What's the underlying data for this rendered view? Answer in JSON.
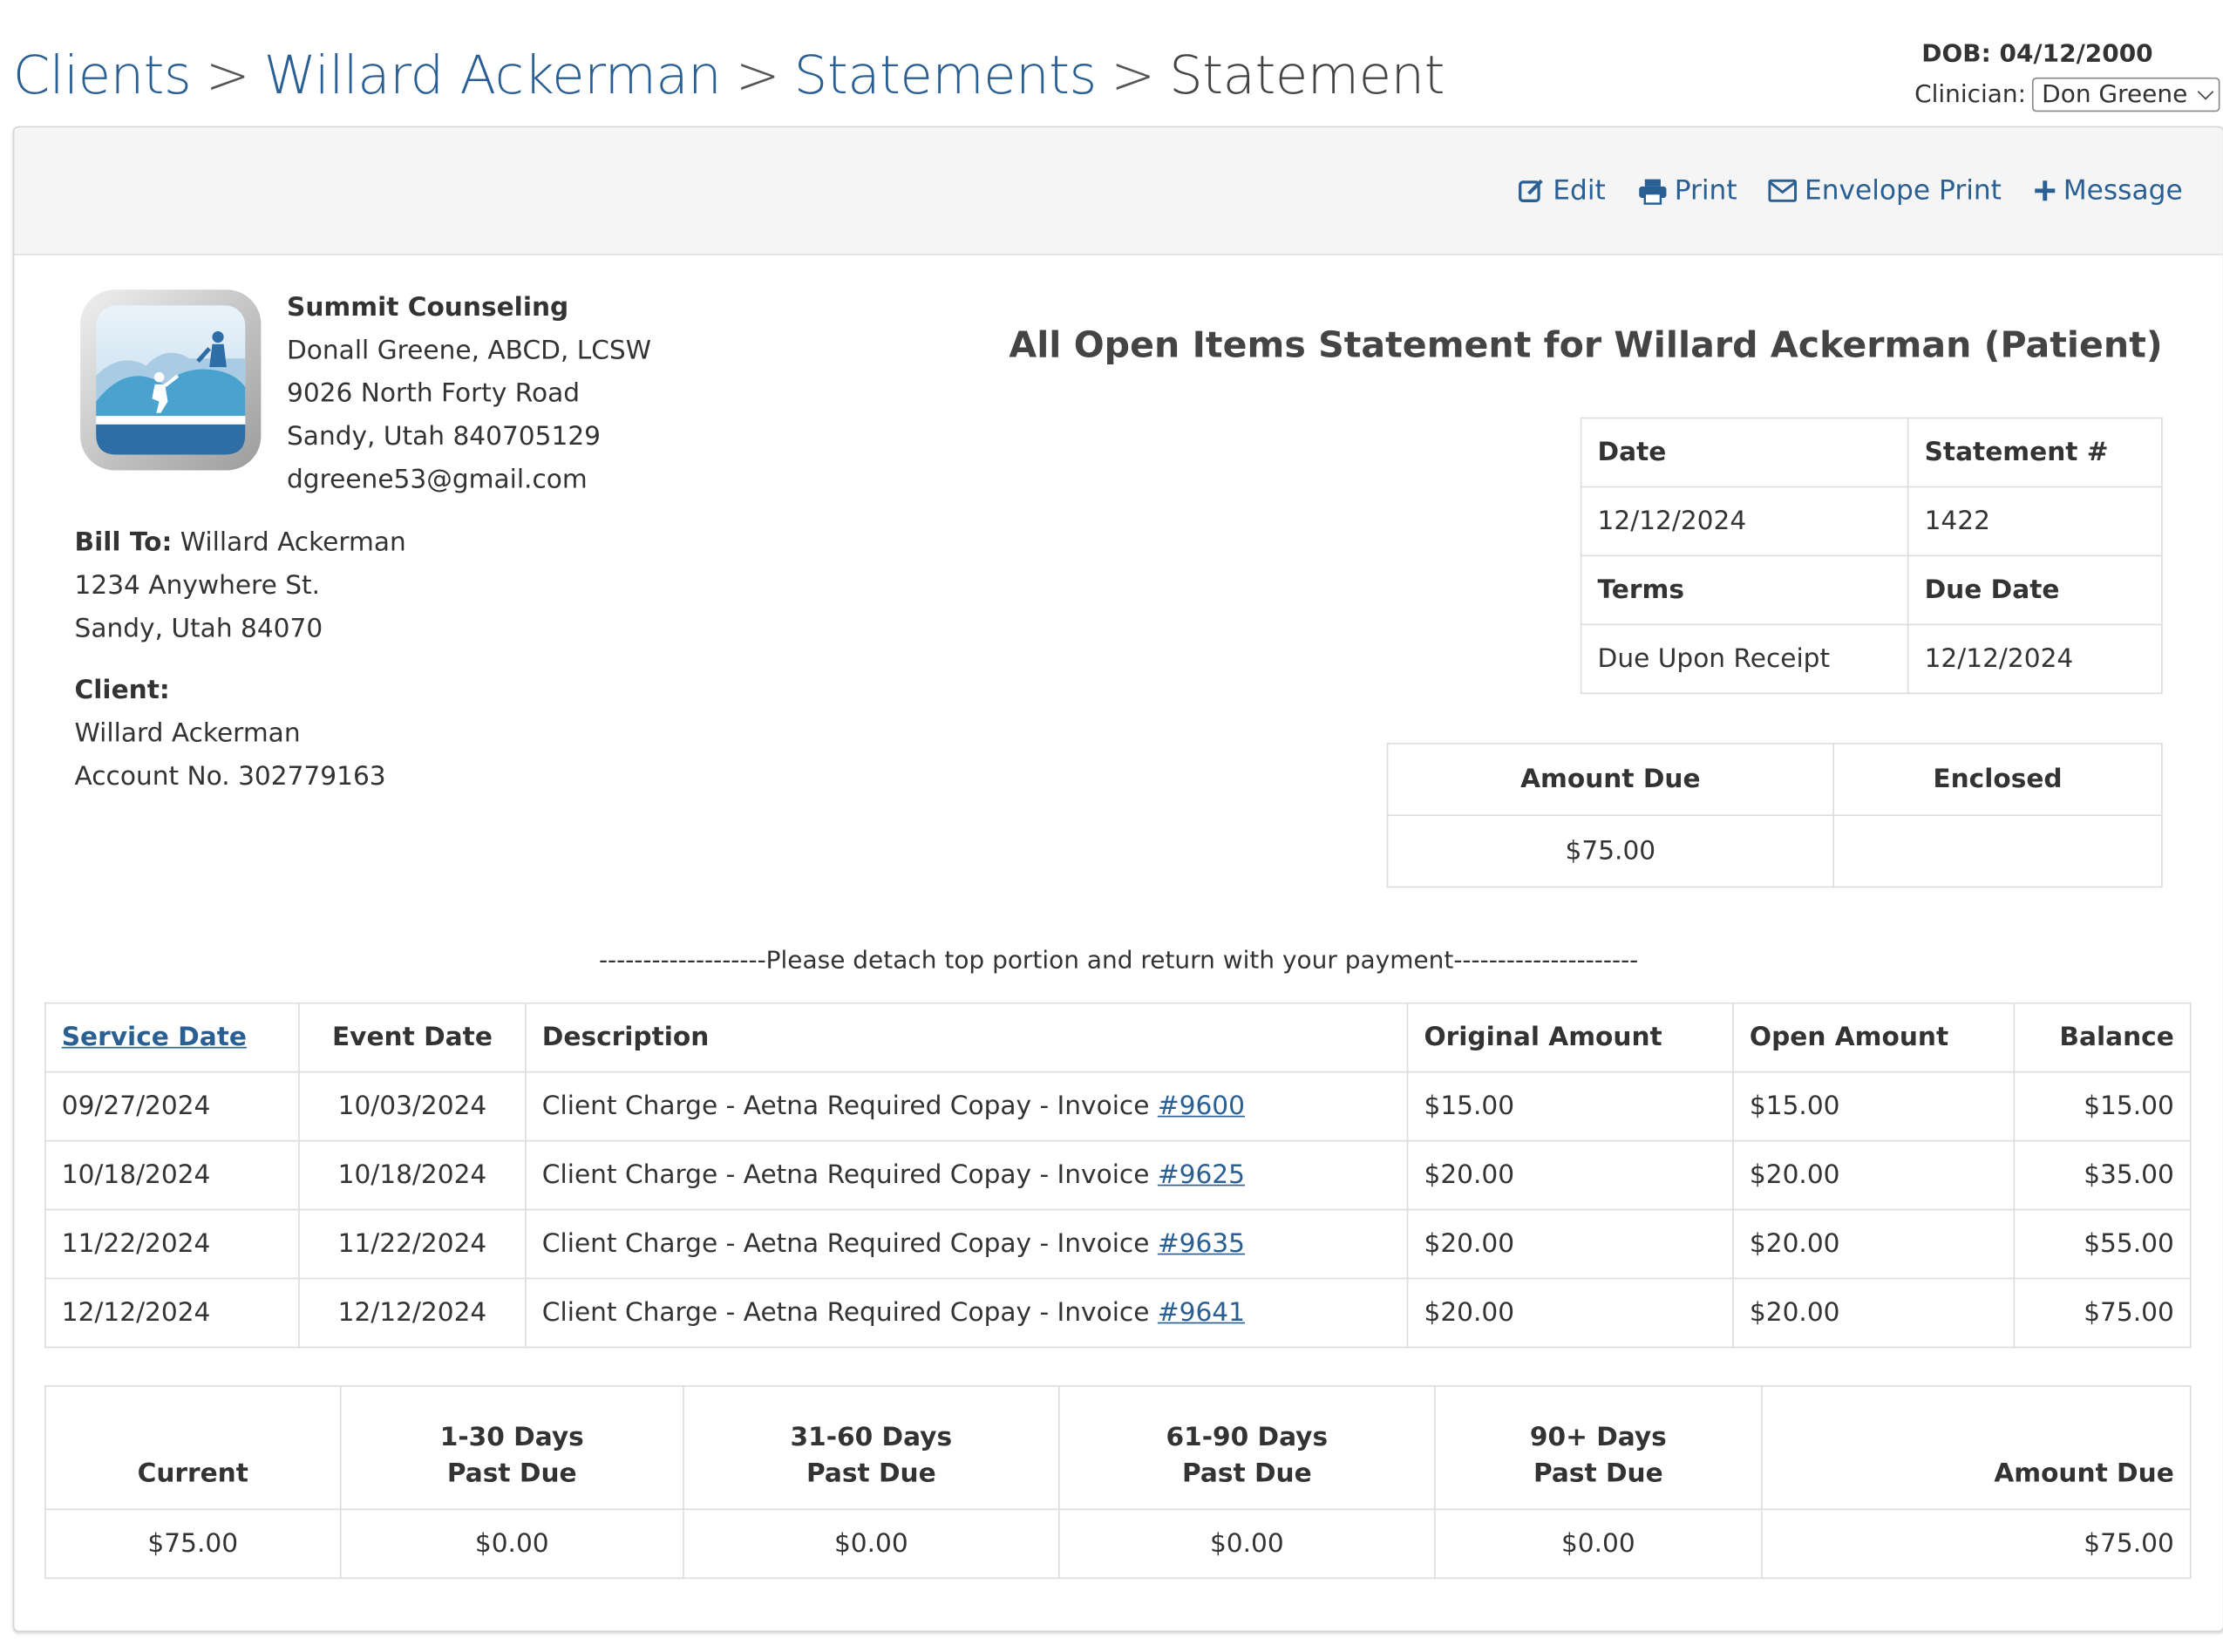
{
  "breadcrumb": {
    "clients": "Clients",
    "client_name": "Willard Ackerman",
    "statements": "Statements",
    "current": "Statement",
    "separator": ">"
  },
  "header": {
    "dob": "DOB: 04/12/2000",
    "clinician_label": "Clinician:",
    "clinician_value": "Don Greene"
  },
  "toolbar": {
    "edit": "Edit",
    "print": "Print",
    "envelope_print": "Envelope Print",
    "message": "Message"
  },
  "practice": {
    "name": "Summit Counseling",
    "clinician": "Donall Greene, ABCD, LCSW",
    "address1": "9026 North Forty Road",
    "address2": "Sandy, Utah 840705129",
    "email": "dgreene53@gmail.com"
  },
  "bill_to": {
    "label": "Bill To:",
    "name": "Willard Ackerman",
    "address1": "1234 Anywhere St.",
    "address2": "Sandy, Utah 84070"
  },
  "client": {
    "label": "Client:",
    "name": "Willard Ackerman",
    "account": "Account No. 302779163"
  },
  "statement": {
    "title": "All Open Items Statement for Willard Ackerman (Patient)",
    "date_label": "Date",
    "date": "12/12/2024",
    "number_label": "Statement #",
    "number": "1422",
    "terms_label": "Terms",
    "terms": "Due Upon Receipt",
    "due_date_label": "Due Date",
    "due_date": "12/12/2024",
    "amount_due_label": "Amount Due",
    "amount_due": "$75.00",
    "enclosed_label": "Enclosed",
    "enclosed": ""
  },
  "detach_text": "-------------------Please detach top portion and return with your payment---------------------",
  "items": {
    "headers": [
      "Service Date",
      "Event Date",
      "Description",
      "Original Amount",
      "Open Amount",
      "Balance"
    ],
    "rows": [
      {
        "service_date": "09/27/2024",
        "event_date": "10/03/2024",
        "description": "Client Charge - Aetna Required Copay - Invoice ",
        "invoice": "#9600",
        "original": "$15.00",
        "open": "$15.00",
        "balance": "$15.00"
      },
      {
        "service_date": "10/18/2024",
        "event_date": "10/18/2024",
        "description": "Client Charge - Aetna Required Copay - Invoice ",
        "invoice": "#9625",
        "original": "$20.00",
        "open": "$20.00",
        "balance": "$35.00"
      },
      {
        "service_date": "11/22/2024",
        "event_date": "11/22/2024",
        "description": "Client Charge - Aetna Required Copay - Invoice ",
        "invoice": "#9635",
        "original": "$20.00",
        "open": "$20.00",
        "balance": "$55.00"
      },
      {
        "service_date": "12/12/2024",
        "event_date": "12/12/2024",
        "description": "Client Charge - Aetna Required Copay - Invoice ",
        "invoice": "#9641",
        "original": "$20.00",
        "open": "$20.00",
        "balance": "$75.00"
      }
    ]
  },
  "aging": {
    "headers": [
      {
        "line1": "",
        "line2": "Current"
      },
      {
        "line1": "1-30 Days",
        "line2": "Past Due"
      },
      {
        "line1": "31-60 Days",
        "line2": "Past Due"
      },
      {
        "line1": "61-90 Days",
        "line2": "Past Due"
      },
      {
        "line1": "90+ Days",
        "line2": "Past Due"
      },
      {
        "line1": "",
        "line2": "Amount Due"
      }
    ],
    "values": [
      "$75.00",
      "$0.00",
      "$0.00",
      "$0.00",
      "$0.00",
      "$75.00"
    ]
  },
  "colors": {
    "link": "#2a5f93",
    "toolbar_bg": "#f5f5f5",
    "border": "#dddddd"
  },
  "icons": [
    "edit-icon",
    "print-icon",
    "envelope-icon",
    "plus-icon",
    "chevron-down-icon",
    "practice-logo"
  ]
}
